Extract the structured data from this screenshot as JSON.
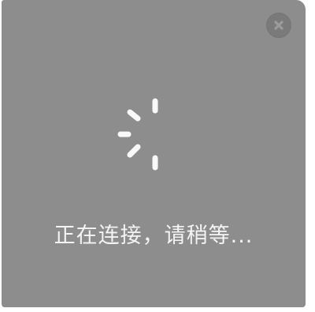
{
  "dialog": {
    "background": "#8d8d8d",
    "close_icon": "close-circle-x",
    "spinner_icon": "loading-spinner",
    "status_text": "正在连接，请稍等..."
  }
}
